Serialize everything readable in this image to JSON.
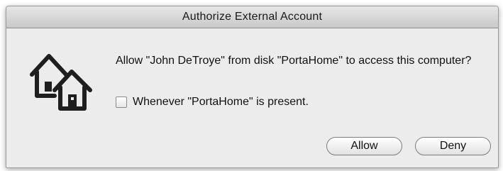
{
  "window": {
    "title": "Authorize External Account"
  },
  "dialog": {
    "icon": "home-accounts-icon",
    "message": "Allow \"John DeTroye\" from disk \"PortaHome\" to access this computer?",
    "option": {
      "label": "Whenever \"PortaHome\" is present.",
      "checked": false
    },
    "buttons": {
      "allow": "Allow",
      "deny": "Deny"
    }
  }
}
